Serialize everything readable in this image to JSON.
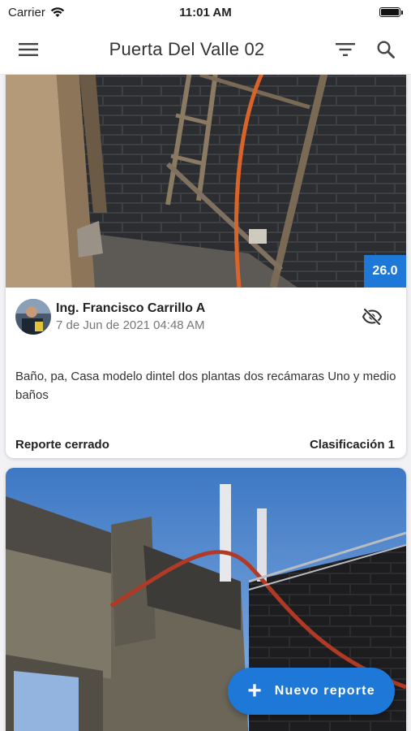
{
  "status_bar": {
    "carrier": "Carrier",
    "time": "11:01 AM"
  },
  "app_bar": {
    "title": "Puerta Del Valle 02",
    "icons": [
      "menu-icon",
      "filter-icon",
      "search-icon"
    ]
  },
  "reports": [
    {
      "score": "26.0",
      "author": "Ing. Francisco Carrillo A",
      "date": "7 de Jun de 2021 04:48 AM",
      "description": "Baño, pa, Casa modelo dintel dos plantas dos recámaras Uno y medio baños",
      "status": "Reporte cerrado",
      "classification": "Clasificación 1",
      "visibility_icon": "eye-off-icon"
    }
  ],
  "fab": {
    "label": "Nuevo reporte",
    "icon": "plus-icon"
  },
  "colors": {
    "accent": "#1e78d7",
    "background": "#f2f2f4"
  }
}
